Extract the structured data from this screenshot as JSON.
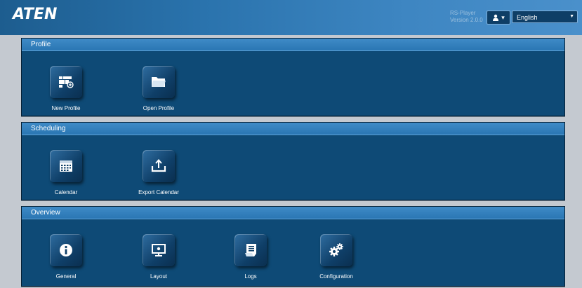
{
  "header": {
    "logo": "ATEN",
    "app_name": "RS-Player",
    "version": "Version 2.0.0",
    "user_icon": "user-icon",
    "language": "English"
  },
  "panels": [
    {
      "title": "Profile",
      "tiles": [
        {
          "label": "New Profile",
          "icon": "new-profile-icon"
        },
        {
          "label": "Open Profile",
          "icon": "folder-icon"
        }
      ]
    },
    {
      "title": "Scheduling",
      "tiles": [
        {
          "label": "Calendar",
          "icon": "calendar-icon"
        },
        {
          "label": "Export Calendar",
          "icon": "export-icon"
        }
      ]
    },
    {
      "title": "Overview",
      "tiles": [
        {
          "label": "General",
          "icon": "info-icon"
        },
        {
          "label": "Layout",
          "icon": "monitor-icon"
        },
        {
          "label": "Logs",
          "icon": "logs-icon"
        },
        {
          "label": "Configuration",
          "icon": "gears-icon"
        }
      ]
    }
  ]
}
